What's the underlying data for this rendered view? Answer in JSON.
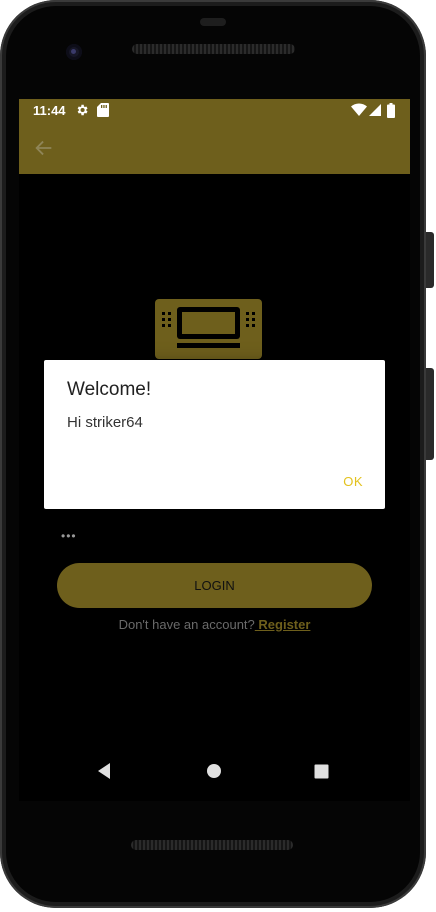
{
  "status_bar": {
    "time": "11:44",
    "icons": [
      "settings-icon",
      "sd-card-icon",
      "wifi-icon",
      "signal-icon",
      "battery-icon"
    ]
  },
  "app_bar": {
    "back_icon": "arrow-back-icon"
  },
  "dialog": {
    "title": "Welcome!",
    "message": "Hi striker64",
    "ok_label": "OK"
  },
  "login_form": {
    "password_value": "•••",
    "login_label": "LOGIN",
    "register_prompt": "Don't have an account?",
    "register_link": " Register"
  },
  "nav_bar": {
    "icons": [
      "back-triangle-icon",
      "home-circle-icon",
      "recents-square-icon"
    ]
  },
  "colors": {
    "accent": "#6e5f1c",
    "ok_text": "#e3c21e",
    "background": "#000000",
    "dialog_bg": "#ffffff"
  }
}
